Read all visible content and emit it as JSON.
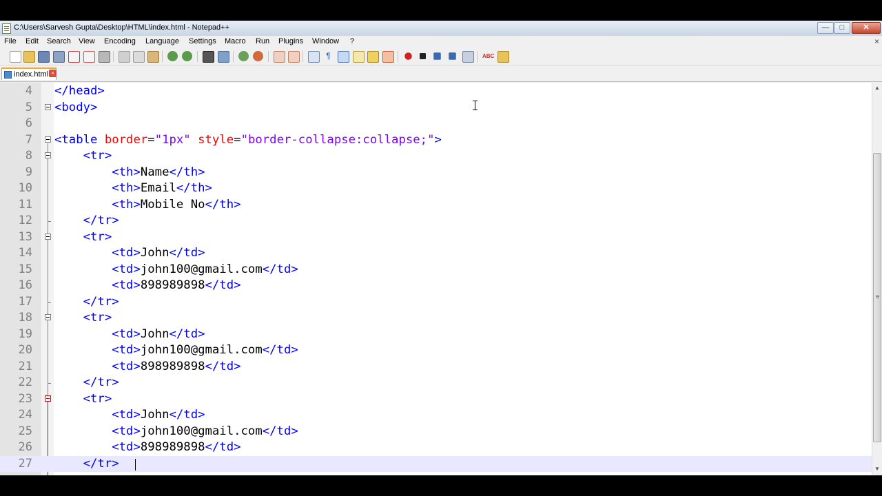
{
  "window": {
    "title": "C:\\Users\\Sarvesh Gupta\\Desktop\\HTML\\index.html - Notepad++",
    "buttons": {
      "minimize": "—",
      "maximize": "□",
      "close": "✕"
    }
  },
  "menu": {
    "items": [
      "File",
      "Edit",
      "Search",
      "View",
      "Encoding",
      "Language",
      "Settings",
      "Macro",
      "Run",
      "Plugins",
      "Window",
      "?"
    ],
    "close_label": "×"
  },
  "toolbar": {
    "icons": [
      "new-file-icon",
      "open-file-icon",
      "save-icon",
      "save-all-icon",
      "close-file-icon",
      "close-all-icon",
      "print-icon",
      "cut-icon",
      "copy-icon",
      "paste-icon",
      "undo-icon",
      "redo-icon",
      "find-icon",
      "replace-icon",
      "zoom-in-icon",
      "zoom-out-icon",
      "sync-vertical-icon",
      "sync-horizontal-icon",
      "word-wrap-icon",
      "show-all-chars-icon",
      "indent-guide-icon",
      "user-lang-icon",
      "doc-map-icon",
      "function-list-icon",
      "record-macro-icon",
      "stop-record-icon",
      "play-macro-icon",
      "run-multiple-icon",
      "save-macro-icon",
      "spell-check-icon",
      "folder-icon"
    ]
  },
  "tabs": [
    {
      "label": "index.html",
      "active": true,
      "close_label": "×"
    }
  ],
  "editor": {
    "lines": [
      {
        "num": "4",
        "tokens": [
          {
            "c": "t",
            "s": "</head>"
          }
        ]
      },
      {
        "num": "5",
        "tokens": [
          {
            "c": "t",
            "s": "<body>"
          }
        ]
      },
      {
        "num": "6",
        "tokens": []
      },
      {
        "num": "7",
        "tokens": [
          {
            "c": "t",
            "s": "<table "
          },
          {
            "c": "a",
            "s": "border"
          },
          {
            "c": "x",
            "s": "="
          },
          {
            "c": "v",
            "s": "\"1px\""
          },
          {
            "c": "x",
            "s": " "
          },
          {
            "c": "a",
            "s": "style"
          },
          {
            "c": "x",
            "s": "="
          },
          {
            "c": "v",
            "s": "\"border-collapse:collapse;\""
          },
          {
            "c": "t",
            "s": ">"
          }
        ]
      },
      {
        "num": "8",
        "tokens": [
          {
            "c": "x",
            "s": "    "
          },
          {
            "c": "t",
            "s": "<tr>"
          }
        ]
      },
      {
        "num": "9",
        "tokens": [
          {
            "c": "x",
            "s": "        "
          },
          {
            "c": "t",
            "s": "<th>"
          },
          {
            "c": "x",
            "s": "Name"
          },
          {
            "c": "t",
            "s": "</th>"
          }
        ]
      },
      {
        "num": "10",
        "tokens": [
          {
            "c": "x",
            "s": "        "
          },
          {
            "c": "t",
            "s": "<th>"
          },
          {
            "c": "x",
            "s": "Email"
          },
          {
            "c": "t",
            "s": "</th>"
          }
        ]
      },
      {
        "num": "11",
        "tokens": [
          {
            "c": "x",
            "s": "        "
          },
          {
            "c": "t",
            "s": "<th>"
          },
          {
            "c": "x",
            "s": "Mobile No"
          },
          {
            "c": "t",
            "s": "</th>"
          }
        ]
      },
      {
        "num": "12",
        "tokens": [
          {
            "c": "x",
            "s": "    "
          },
          {
            "c": "t",
            "s": "</tr>"
          }
        ]
      },
      {
        "num": "13",
        "tokens": [
          {
            "c": "x",
            "s": "    "
          },
          {
            "c": "t",
            "s": "<tr>"
          }
        ]
      },
      {
        "num": "14",
        "tokens": [
          {
            "c": "x",
            "s": "        "
          },
          {
            "c": "t",
            "s": "<td>"
          },
          {
            "c": "x",
            "s": "John"
          },
          {
            "c": "t",
            "s": "</td>"
          }
        ]
      },
      {
        "num": "15",
        "tokens": [
          {
            "c": "x",
            "s": "        "
          },
          {
            "c": "t",
            "s": "<td>"
          },
          {
            "c": "x",
            "s": "john100@gmail.com"
          },
          {
            "c": "t",
            "s": "</td>"
          }
        ]
      },
      {
        "num": "16",
        "tokens": [
          {
            "c": "x",
            "s": "        "
          },
          {
            "c": "t",
            "s": "<td>"
          },
          {
            "c": "x",
            "s": "898989898"
          },
          {
            "c": "t",
            "s": "</td>"
          }
        ]
      },
      {
        "num": "17",
        "tokens": [
          {
            "c": "x",
            "s": "    "
          },
          {
            "c": "t",
            "s": "</tr>"
          }
        ]
      },
      {
        "num": "18",
        "tokens": [
          {
            "c": "x",
            "s": "    "
          },
          {
            "c": "t",
            "s": "<tr>"
          }
        ]
      },
      {
        "num": "19",
        "tokens": [
          {
            "c": "x",
            "s": "        "
          },
          {
            "c": "t",
            "s": "<td>"
          },
          {
            "c": "x",
            "s": "John"
          },
          {
            "c": "t",
            "s": "</td>"
          }
        ]
      },
      {
        "num": "20",
        "tokens": [
          {
            "c": "x",
            "s": "        "
          },
          {
            "c": "t",
            "s": "<td>"
          },
          {
            "c": "x",
            "s": "john100@gmail.com"
          },
          {
            "c": "t",
            "s": "</td>"
          }
        ]
      },
      {
        "num": "21",
        "tokens": [
          {
            "c": "x",
            "s": "        "
          },
          {
            "c": "t",
            "s": "<td>"
          },
          {
            "c": "x",
            "s": "898989898"
          },
          {
            "c": "t",
            "s": "</td>"
          }
        ]
      },
      {
        "num": "22",
        "tokens": [
          {
            "c": "x",
            "s": "    "
          },
          {
            "c": "t",
            "s": "</tr>"
          }
        ]
      },
      {
        "num": "23",
        "tokens": [
          {
            "c": "x",
            "s": "    "
          },
          {
            "c": "t",
            "s": "<tr>"
          }
        ]
      },
      {
        "num": "24",
        "tokens": [
          {
            "c": "x",
            "s": "        "
          },
          {
            "c": "t",
            "s": "<td>"
          },
          {
            "c": "x",
            "s": "John"
          },
          {
            "c": "t",
            "s": "</td>"
          }
        ]
      },
      {
        "num": "25",
        "tokens": [
          {
            "c": "x",
            "s": "        "
          },
          {
            "c": "t",
            "s": "<td>"
          },
          {
            "c": "x",
            "s": "john100@gmail.com"
          },
          {
            "c": "t",
            "s": "</td>"
          }
        ]
      },
      {
        "num": "26",
        "tokens": [
          {
            "c": "x",
            "s": "        "
          },
          {
            "c": "t",
            "s": "<td>"
          },
          {
            "c": "x",
            "s": "898989898"
          },
          {
            "c": "t",
            "s": "</td>"
          }
        ]
      },
      {
        "num": "27",
        "tokens": [
          {
            "c": "x",
            "s": "    "
          },
          {
            "c": "t",
            "s": "</tr>"
          }
        ]
      }
    ],
    "current_line": "27",
    "fold_open_lines": [
      "5",
      "7",
      "8",
      "13",
      "18",
      "23"
    ],
    "fold_end_lines": [
      "12",
      "17",
      "22"
    ],
    "highlighted_fold_lines": [
      "23"
    ]
  },
  "colors": {
    "tag": "#0000ff",
    "attribute": "#ff0000",
    "attribute_value": "#8000ff",
    "text": "#000000",
    "line_number": "#808080",
    "current_line_bg": "#e8e8ff",
    "active_tab_accent": "#f5a623"
  }
}
